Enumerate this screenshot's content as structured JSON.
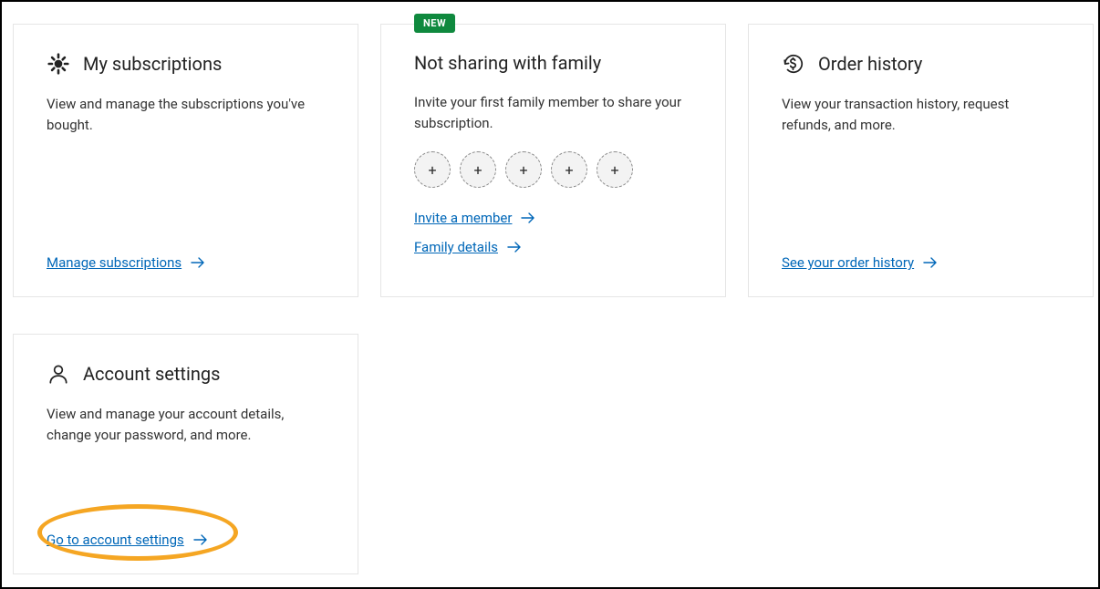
{
  "cards": {
    "subscriptions": {
      "title": "My subscriptions",
      "desc": "View and manage the subscriptions you've bought.",
      "link": "Manage subscriptions"
    },
    "family": {
      "badge": "NEW",
      "title": "Not sharing with family",
      "desc": "Invite your first family member to share your subscription.",
      "add_glyph": "+",
      "link_invite": "Invite a member",
      "link_details": "Family details"
    },
    "orders": {
      "title": "Order history",
      "desc": "View your transaction history, request refunds, and more.",
      "link": "See your order history"
    },
    "account": {
      "title": "Account settings",
      "desc": "View and manage your account details, change your password, and more.",
      "link": "Go to account settings"
    }
  }
}
